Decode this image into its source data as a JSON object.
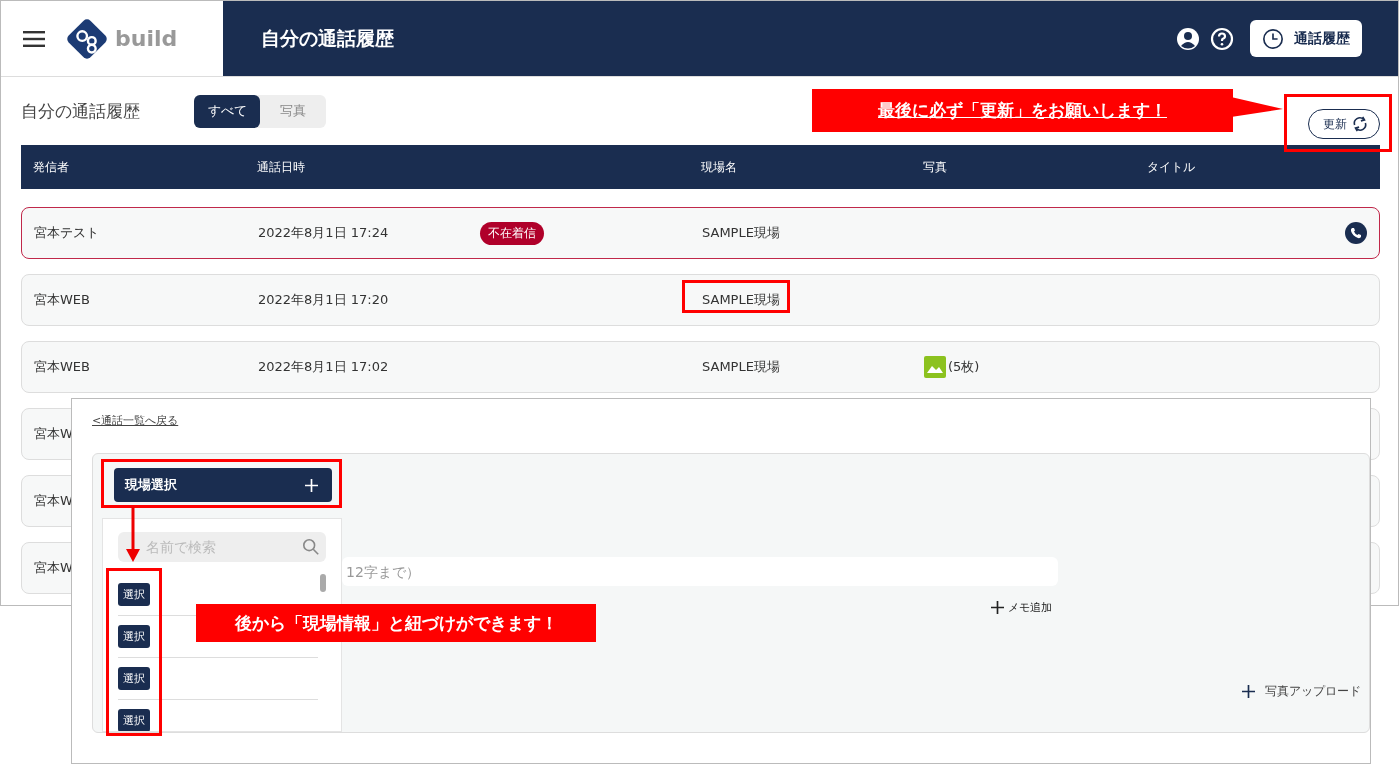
{
  "header": {
    "app_name": "build",
    "page_title": "自分の通話履歴",
    "history_button": "通話履歴"
  },
  "toolbar": {
    "title": "自分の通話履歴",
    "tabs": [
      {
        "label": "すべて",
        "selected": true
      },
      {
        "label": "写真",
        "selected": false
      }
    ],
    "refresh_button": "更新"
  },
  "table": {
    "columns": [
      "発信者",
      "通話日時",
      "現場名",
      "写真",
      "タイトル"
    ],
    "rows": [
      {
        "caller": "宮本テスト",
        "datetime": "2022年8月1日 17:24",
        "badge": "不在着信",
        "site": "SAMPLE現場",
        "missed": true,
        "call_icon": true
      },
      {
        "caller": "宮本WEB",
        "datetime": "2022年8月1日 17:20",
        "site": "SAMPLE現場",
        "missed": false,
        "call_icon": false
      },
      {
        "caller": "宮本WEB",
        "datetime": "2022年8月1日 17:02",
        "site": "SAMPLE現場",
        "photos": "(5枚)",
        "missed": false,
        "call_icon": false
      },
      {
        "caller": "宮本W",
        "missed": false,
        "call_icon": false
      },
      {
        "caller": "宮本W",
        "missed": false,
        "call_icon": false
      },
      {
        "caller": "宮本W",
        "missed": false,
        "call_icon": false
      }
    ]
  },
  "detail": {
    "back_link": "<通話一覧へ戻る",
    "site_select_button": "現場選択",
    "search_placeholder": "名前で検索",
    "select_buttons": [
      "選択",
      "選択",
      "選択",
      "選択"
    ],
    "memo_placeholder": "12字まで）",
    "memo_add": "メモ追加",
    "photo_upload": "写真アップロード"
  },
  "annotations": [
    {
      "text": "最後に必ず「更新」をお願いします！"
    },
    {
      "text": "後から「現場情報」と紐づけができます！"
    }
  ]
}
